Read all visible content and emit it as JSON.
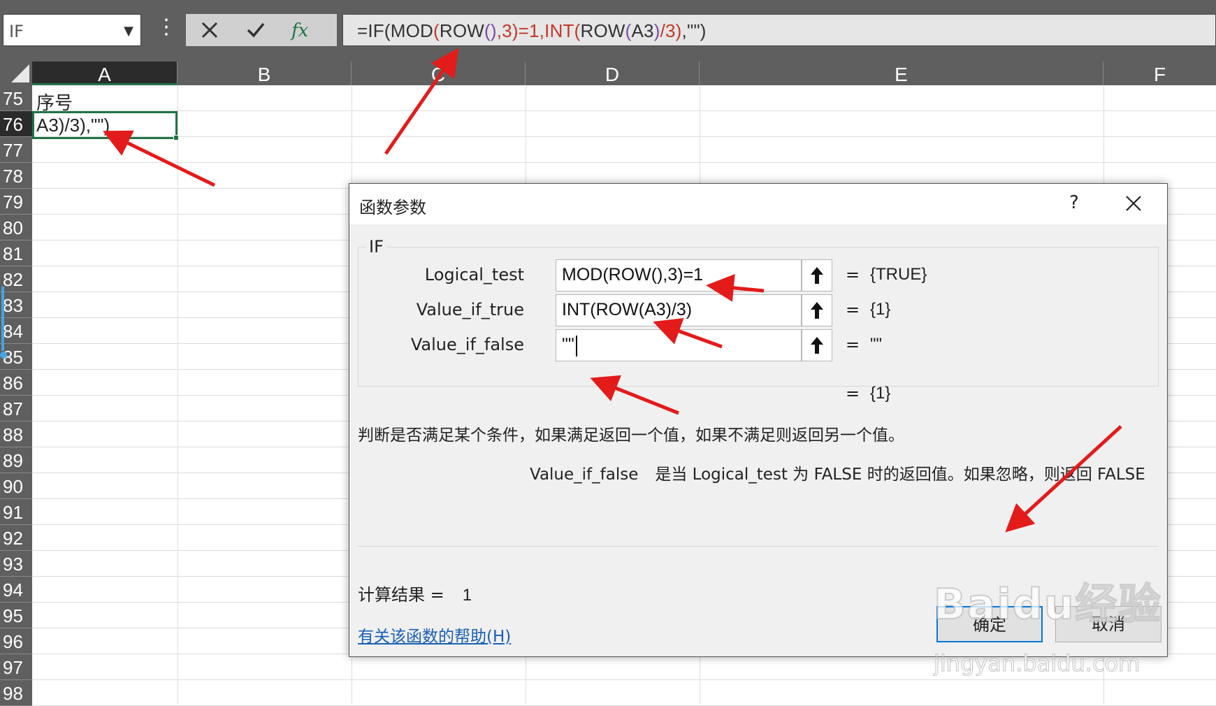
{
  "namebox": {
    "value": "IF"
  },
  "formula_bar": {
    "parts": [
      "=IF(",
      "MOD",
      "(",
      "ROW",
      "()",
      ",3)=1,INT",
      "(",
      "ROW",
      "(",
      "A3",
      ")",
      "/3)",
      ",\"\")"
    ]
  },
  "columns": [
    "A",
    "B",
    "C",
    "D",
    "E",
    "F"
  ],
  "rows": [
    "75",
    "76",
    "77",
    "78",
    "79",
    "80",
    "81",
    "82",
    "83",
    "84",
    "85",
    "86",
    "87",
    "88",
    "89",
    "90",
    "91",
    "92",
    "93",
    "94",
    "95",
    "96",
    "97",
    "98"
  ],
  "cells": {
    "a75": "序号",
    "a76": "A3)/3),\"\")"
  },
  "dialog": {
    "title": "函数参数",
    "help_symbol": "?",
    "function_name": "IF",
    "params": [
      {
        "label": "Logical_test",
        "value": "MOD(ROW(),3)=1",
        "equals": "=",
        "result": "{TRUE}"
      },
      {
        "label": "Value_if_true",
        "value": "INT(ROW(A3)/3)",
        "equals": "=",
        "result": "{1}"
      },
      {
        "label": "Value_if_false",
        "value": "\"\"",
        "equals": "=",
        "result": "\"\""
      }
    ],
    "overall_equals": "=",
    "overall_result": "{1}",
    "description": "判断是否满足某个条件，如果满足返回一个值，如果不满足则返回另一个值。",
    "param_desc_name": "Value_if_false",
    "param_desc_text": "是当 Logical_test 为 FALSE 时的返回值。如果忽略，则返回 FALSE",
    "calc_label": "计算结果 =",
    "calc_value": "1",
    "help_link": "有关该函数的帮助(H)",
    "ok_label": "确定",
    "cancel_label": "取消"
  },
  "watermark": {
    "brand": "Baidu经验",
    "url": "jingyan.baidu.com"
  },
  "colors": {
    "accent": "#217346",
    "annotation_arrow": "#e31b1b",
    "toolbar": "#5f5f5f",
    "link": "#1a5fb4"
  }
}
